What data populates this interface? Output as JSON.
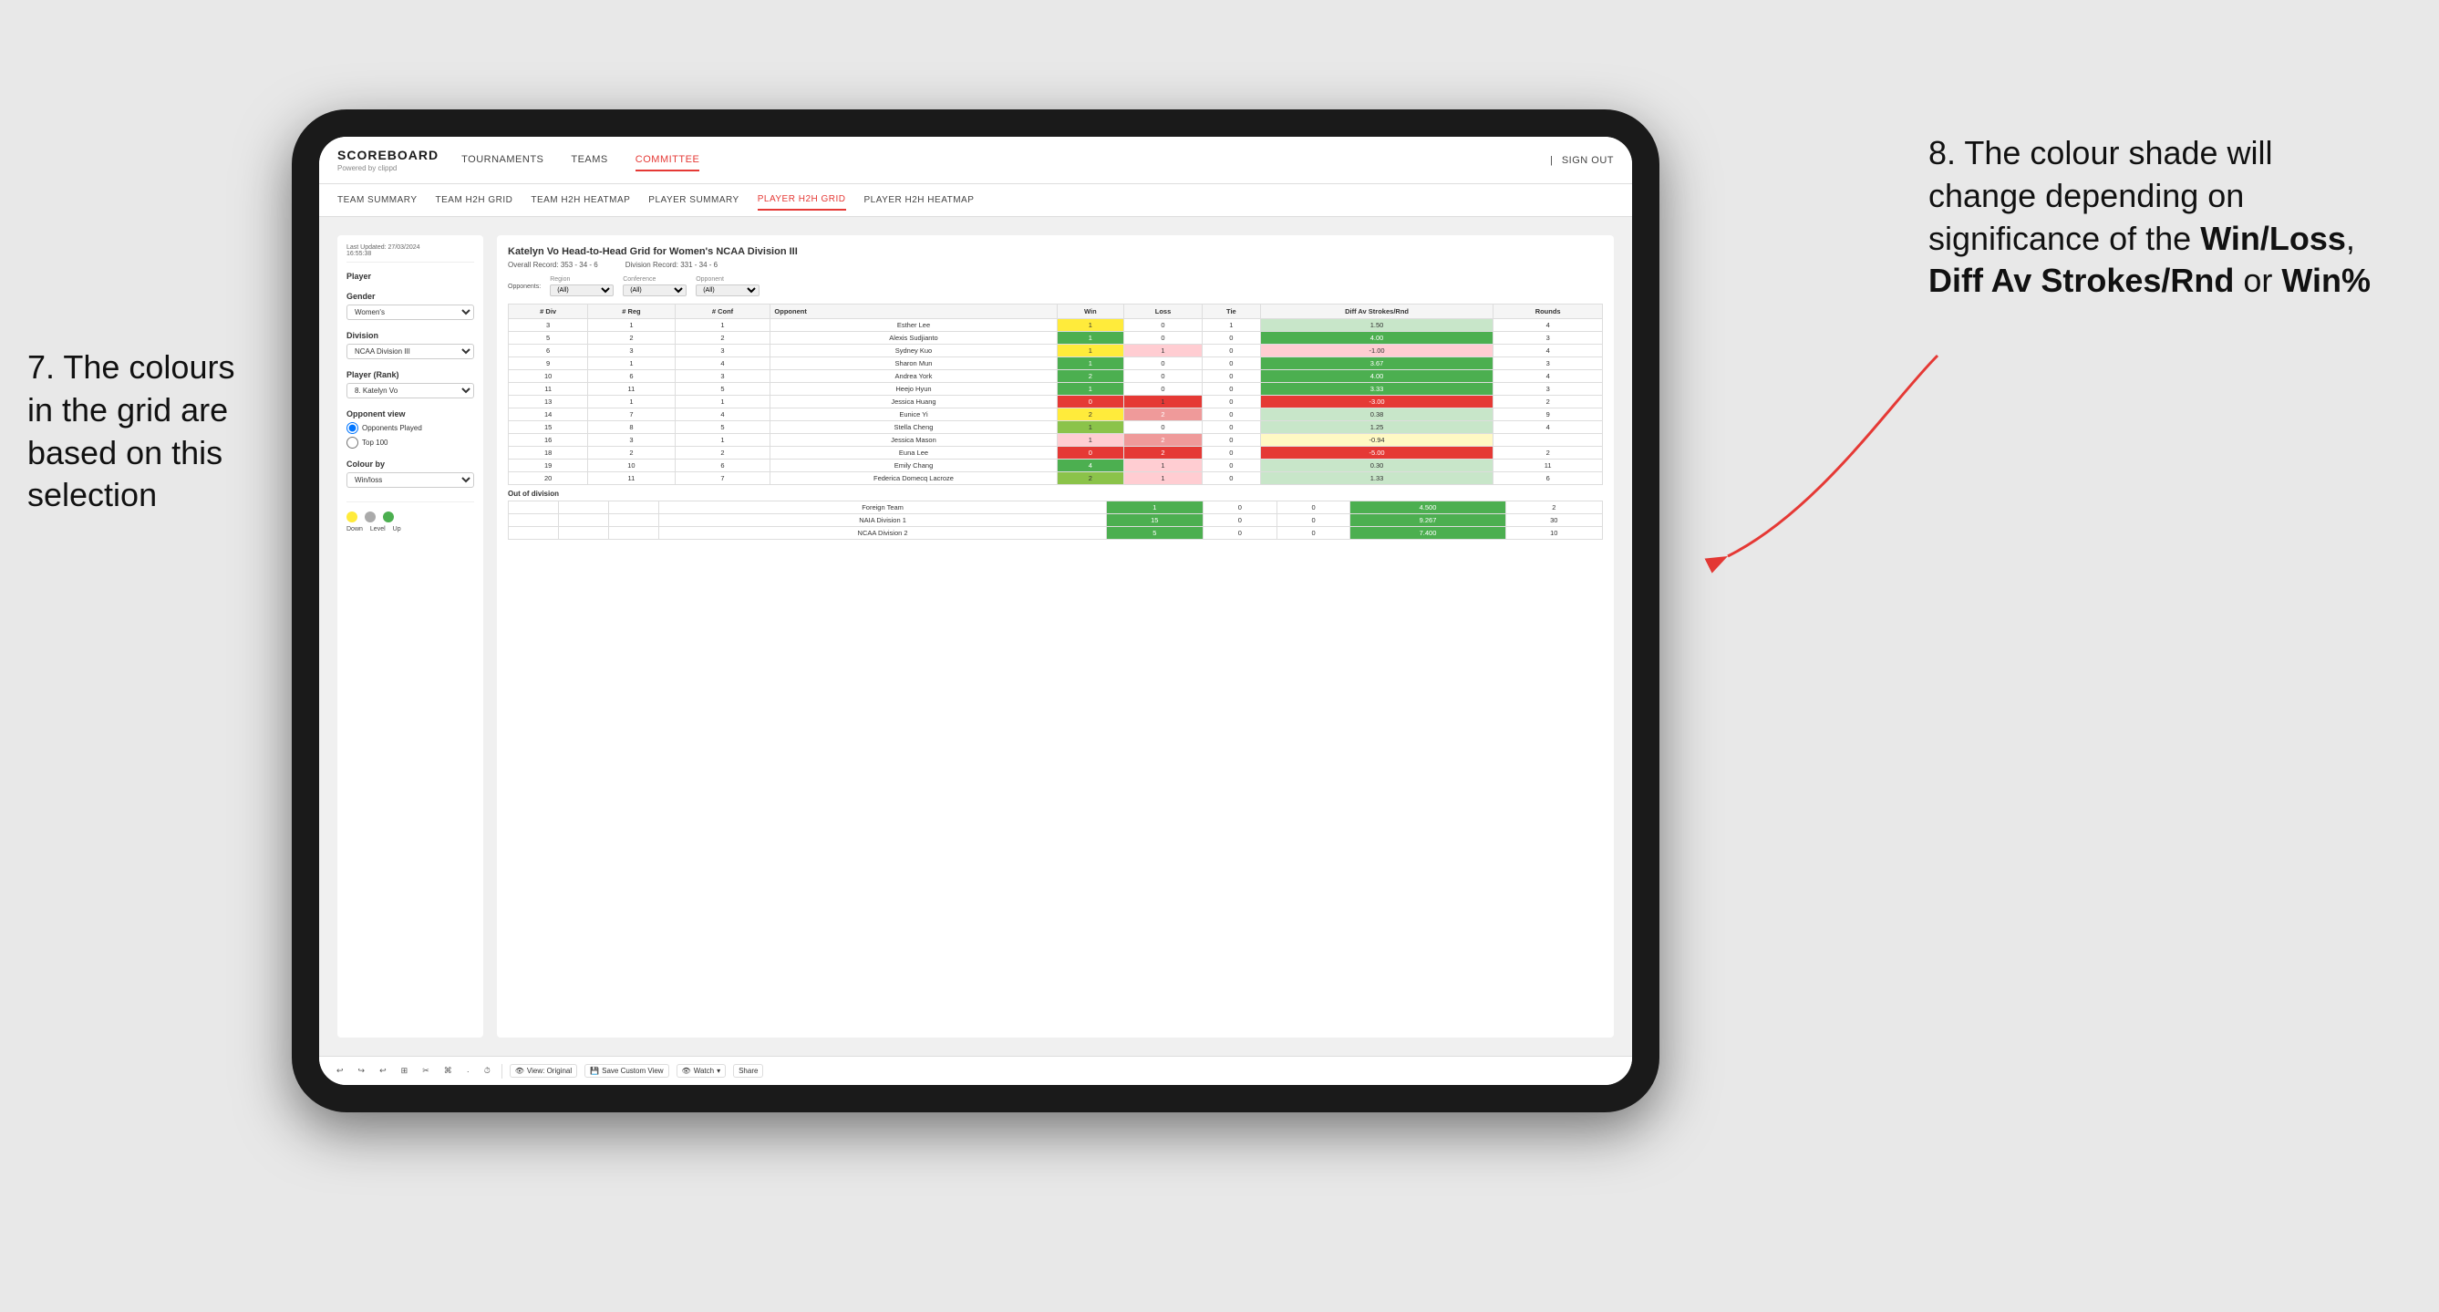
{
  "app": {
    "logo": "SCOREBOARD",
    "logo_sub": "Powered by clippd",
    "nav_links": [
      "TOURNAMENTS",
      "TEAMS",
      "COMMITTEE"
    ],
    "nav_right": [
      "Sign out"
    ],
    "sub_nav_links": [
      "TEAM SUMMARY",
      "TEAM H2H GRID",
      "TEAM H2H HEATMAP",
      "PLAYER SUMMARY",
      "PLAYER H2H GRID",
      "PLAYER H2H HEATMAP"
    ],
    "active_main_nav": "COMMITTEE",
    "active_sub_nav": "PLAYER H2H GRID"
  },
  "left_panel": {
    "last_updated_label": "Last Updated: 27/03/2024",
    "last_updated_time": "16:55:38",
    "player_label": "Player",
    "gender_label": "Gender",
    "gender_value": "Women's",
    "division_label": "Division",
    "division_value": "NCAA Division III",
    "player_rank_label": "Player (Rank)",
    "player_rank_value": "8. Katelyn Vo",
    "opponent_view_label": "Opponent view",
    "opponent_played": "Opponents Played",
    "opponent_top100": "Top 100",
    "colour_by_label": "Colour by",
    "colour_by_value": "Win/loss",
    "legend": {
      "down_label": "Down",
      "level_label": "Level",
      "up_label": "Up"
    }
  },
  "grid": {
    "title": "Katelyn Vo Head-to-Head Grid for Women's NCAA Division III",
    "overall_record_label": "Overall Record:",
    "overall_record": "353 - 34 - 6",
    "division_record_label": "Division Record:",
    "division_record": "331 - 34 - 6",
    "filter_opponents_label": "Opponents:",
    "filter_region_label": "Region",
    "filter_region_value": "(All)",
    "filter_conference_label": "Conference",
    "filter_conference_value": "(All)",
    "filter_opponent_label": "Opponent",
    "filter_opponent_value": "(All)",
    "columns": [
      "# Div",
      "# Reg",
      "# Conf",
      "Opponent",
      "Win",
      "Loss",
      "Tie",
      "Diff Av Strokes/Rnd",
      "Rounds"
    ],
    "rows": [
      {
        "div": "3",
        "reg": "1",
        "conf": "1",
        "opponent": "Esther Lee",
        "win": 1,
        "loss": 0,
        "tie": 1,
        "diff": "1.50",
        "rounds": "4",
        "win_color": "yellow",
        "diff_color": "green-light"
      },
      {
        "div": "5",
        "reg": "2",
        "conf": "2",
        "opponent": "Alexis Sudjianto",
        "win": 1,
        "loss": 0,
        "tie": 0,
        "diff": "4.00",
        "rounds": "3",
        "win_color": "green-dark",
        "diff_color": "green-dark"
      },
      {
        "div": "6",
        "reg": "3",
        "conf": "3",
        "opponent": "Sydney Kuo",
        "win": 1,
        "loss": 1,
        "tie": 0,
        "diff": "-1.00",
        "rounds": "4",
        "win_color": "yellow",
        "diff_color": "red-light"
      },
      {
        "div": "9",
        "reg": "1",
        "conf": "4",
        "opponent": "Sharon Mun",
        "win": 1,
        "loss": 0,
        "tie": 0,
        "diff": "3.67",
        "rounds": "3",
        "win_color": "green-dark",
        "diff_color": "green-dark"
      },
      {
        "div": "10",
        "reg": "6",
        "conf": "3",
        "opponent": "Andrea York",
        "win": 2,
        "loss": 0,
        "tie": 0,
        "diff": "4.00",
        "rounds": "4",
        "win_color": "green-dark",
        "diff_color": "green-dark"
      },
      {
        "div": "11",
        "reg": "11",
        "conf": "5",
        "opponent": "Heejo Hyun",
        "win": 1,
        "loss": 0,
        "tie": 0,
        "diff": "3.33",
        "rounds": "3",
        "win_color": "green-dark",
        "diff_color": "green-dark"
      },
      {
        "div": "13",
        "reg": "1",
        "conf": "1",
        "opponent": "Jessica Huang",
        "win": 0,
        "loss": 1,
        "tie": 0,
        "diff": "-3.00",
        "rounds": "2",
        "win_color": "red-dark",
        "diff_color": "red-dark"
      },
      {
        "div": "14",
        "reg": "7",
        "conf": "4",
        "opponent": "Eunice Yi",
        "win": 2,
        "loss": 2,
        "tie": 0,
        "diff": "0.38",
        "rounds": "9",
        "win_color": "yellow",
        "diff_color": "green-light"
      },
      {
        "div": "15",
        "reg": "8",
        "conf": "5",
        "opponent": "Stella Cheng",
        "win": 1,
        "loss": 0,
        "tie": 0,
        "diff": "1.25",
        "rounds": "4",
        "win_color": "green-med",
        "diff_color": "green-light"
      },
      {
        "div": "16",
        "reg": "3",
        "conf": "1",
        "opponent": "Jessica Mason",
        "win": 1,
        "loss": 2,
        "tie": 0,
        "diff": "-0.94",
        "rounds": "",
        "win_color": "red-light",
        "diff_color": "yellow-light"
      },
      {
        "div": "18",
        "reg": "2",
        "conf": "2",
        "opponent": "Euna Lee",
        "win": 0,
        "loss": 2,
        "tie": 0,
        "diff": "-5.00",
        "rounds": "2",
        "win_color": "red-dark",
        "diff_color": "red-dark"
      },
      {
        "div": "19",
        "reg": "10",
        "conf": "6",
        "opponent": "Emily Chang",
        "win": 4,
        "loss": 1,
        "tie": 0,
        "diff": "0.30",
        "rounds": "11",
        "win_color": "green-dark",
        "diff_color": "green-light"
      },
      {
        "div": "20",
        "reg": "11",
        "conf": "7",
        "opponent": "Federica Domecq Lacroze",
        "win": 2,
        "loss": 1,
        "tie": 0,
        "diff": "1.33",
        "rounds": "6",
        "win_color": "green-med",
        "diff_color": "green-light"
      }
    ],
    "out_of_division_label": "Out of division",
    "out_of_division_rows": [
      {
        "label": "Foreign Team",
        "win": 1,
        "loss": 0,
        "tie": 0,
        "diff": "4.500",
        "rounds": "2",
        "win_color": "green-dark",
        "diff_color": "green-dark"
      },
      {
        "label": "NAIA Division 1",
        "win": 15,
        "loss": 0,
        "tie": 0,
        "diff": "9.267",
        "rounds": "30",
        "win_color": "green-dark",
        "diff_color": "green-dark"
      },
      {
        "label": "NCAA Division 2",
        "win": 5,
        "loss": 0,
        "tie": 0,
        "diff": "7.400",
        "rounds": "10",
        "win_color": "green-dark",
        "diff_color": "green-dark"
      }
    ]
  },
  "toolbar": {
    "buttons": [
      "↩",
      "↪",
      "↩",
      "⊞",
      "✂",
      "⌘",
      "·",
      "⏱"
    ],
    "actions": [
      "View: Original",
      "Save Custom View",
      "Watch",
      "Share"
    ]
  },
  "annotation_left": {
    "text": "7. The colours in the grid are based on this selection"
  },
  "annotation_right": {
    "prefix": "8. The colour shade will change depending on significance of the ",
    "bold1": "Win/Loss",
    "sep1": ", ",
    "bold2": "Diff Av Strokes/Rnd",
    "sep2": " or ",
    "bold3": "Win%"
  }
}
